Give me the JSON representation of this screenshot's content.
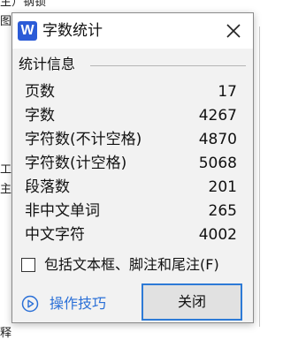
{
  "background": {
    "fragments": [
      "主）钢锁",
      "图",
      "工户",
      "主",
      "释"
    ]
  },
  "dialog": {
    "app_icon_letter": "W",
    "title": "字数统计",
    "group_header": "统计信息",
    "stats": [
      {
        "label": "页数",
        "value": "17"
      },
      {
        "label": "字数",
        "value": "4267"
      },
      {
        "label": "字符数(不计空格)",
        "value": "4870"
      },
      {
        "label": "字符数(计空格)",
        "value": "5068"
      },
      {
        "label": "段落数",
        "value": "201"
      },
      {
        "label": "非中文单词",
        "value": "265"
      },
      {
        "label": "中文字符",
        "value": "4002"
      }
    ],
    "checkbox": {
      "label": "包括文本框、脚注和尾注(F)",
      "checked": false
    },
    "tips_label": "操作技巧",
    "close_label": "关闭"
  },
  "colors": {
    "accent": "#2d7ad6",
    "link": "#2b70d7",
    "app_icon": "#2b5bd7"
  },
  "icons": {
    "app": "wps-writer-icon",
    "close": "close-icon",
    "tips": "play-circle-icon"
  }
}
